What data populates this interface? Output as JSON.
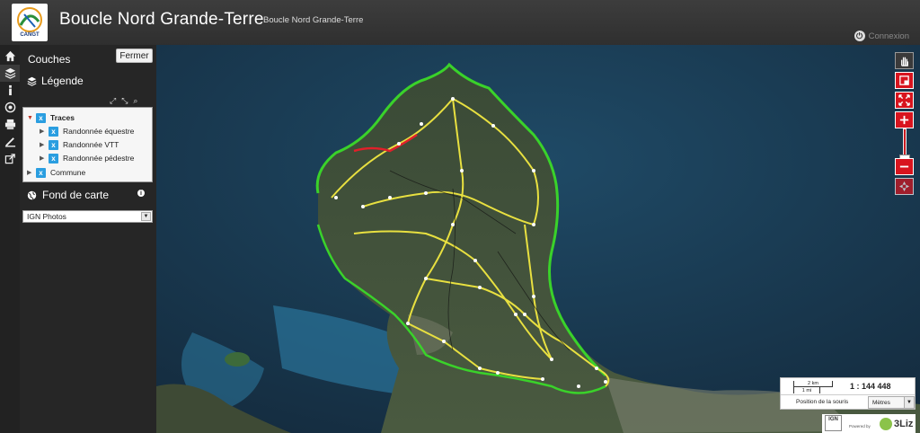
{
  "header": {
    "logo_text": "CANGT",
    "title": "Boucle Nord Grande-Terre",
    "subtitle": "Boucle Nord Grande-Terre",
    "connexion_label": "Connexion"
  },
  "sidebar": {
    "icons": [
      "home-icon",
      "layers-icon",
      "info-icon",
      "locate-icon",
      "print-icon",
      "measure-icon",
      "share-icon"
    ]
  },
  "panel": {
    "title": "Couches",
    "close_label": "Fermer",
    "legend_title": "Légende",
    "tree": [
      {
        "label": "Traces",
        "checked": true,
        "expanded": true,
        "level": 0
      },
      {
        "label": "Randonnée équestre",
        "checked": true,
        "expanded": false,
        "level": 1
      },
      {
        "label": "Randonnée VTT",
        "checked": true,
        "expanded": false,
        "level": 1
      },
      {
        "label": "Randonnée pédestre",
        "checked": true,
        "expanded": false,
        "level": 1
      },
      {
        "label": "Commune",
        "checked": true,
        "expanded": false,
        "level": 0
      }
    ],
    "basemap_title": "Fond de carte",
    "basemap_selected": "IGN Photos"
  },
  "map": {
    "scale_km": "2 km",
    "scale_mi": "1 mi",
    "scale_ratio": "1 : 144 448",
    "mouse_position_label": "Position de la souris",
    "unit_selected": "Mètres",
    "powered_by": "Powered by",
    "attribution_logo": "IGN",
    "liz_text": "3Liz",
    "colors": {
      "route_yellow": "#e8e040",
      "boundary_green": "#3ad22a",
      "accent_red": "#d8141e"
    }
  }
}
